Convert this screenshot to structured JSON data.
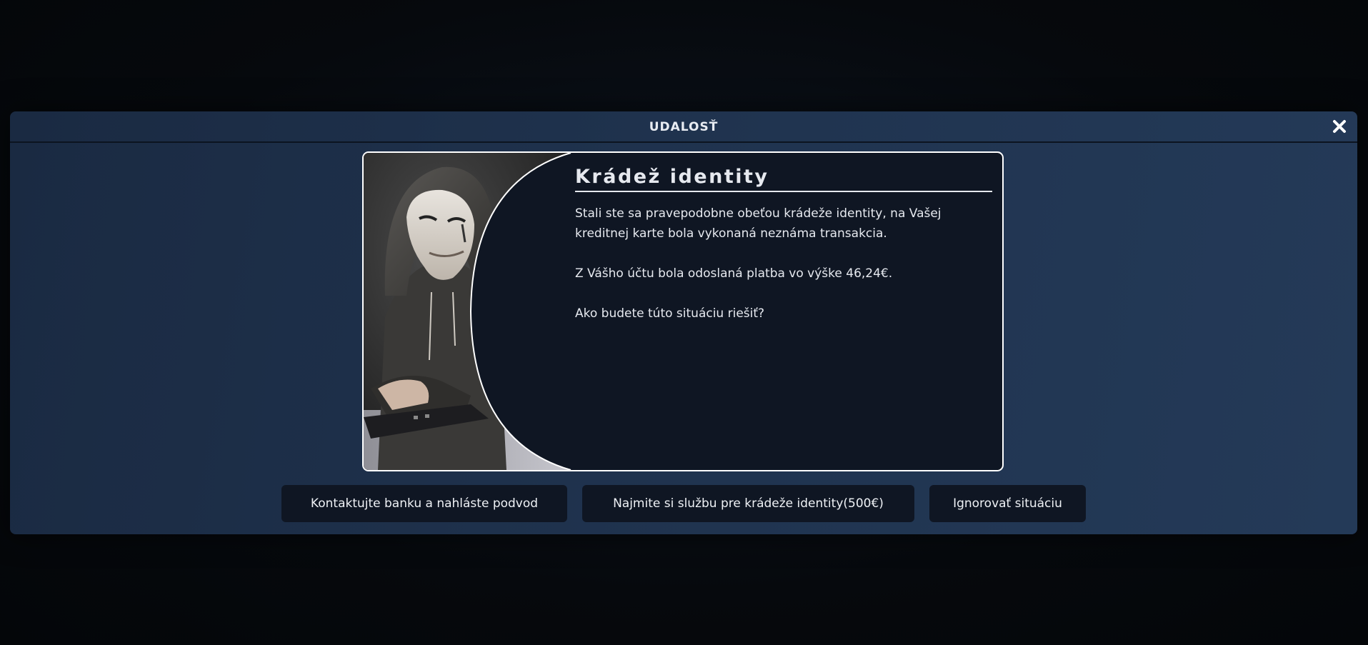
{
  "modal": {
    "title": "UDALOSŤ",
    "close_icon": "close-x-icon"
  },
  "event": {
    "image": "hooded-hacker-mask-keyboard",
    "heading": "Krádež identity",
    "paragraphs": [
      "Stali ste sa pravepodobne obeťou krádeže identity, na Vašej kreditnej karte bola vykonaná neznáma transakcia.",
      "Z Vášho účtu bola odoslaná platba vo výške 46,24€.",
      "Ako budete túto situáciu riešiť?"
    ]
  },
  "actions": [
    {
      "label": "Kontaktujte banku a nahláste podvod"
    },
    {
      "label": "Najmite si službu pre krádeže identity(500€)"
    },
    {
      "label": "Ignorovať situáciu"
    }
  ],
  "colors": {
    "modal_bg": "#203450",
    "card_bg": "#0f1623",
    "text": "#e6e9ef",
    "border": "#ffffff"
  }
}
